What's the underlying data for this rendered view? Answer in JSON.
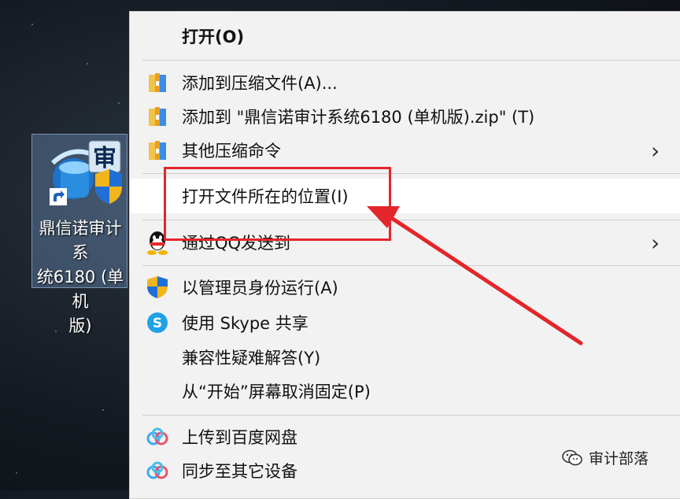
{
  "desktop": {
    "shortcut": {
      "label": "鼎信诺审计系\n统6180 (单机\n版)",
      "badge_text": "审"
    }
  },
  "menu": {
    "items": [
      {
        "label": "打开(O)",
        "bold": true,
        "icon": null,
        "submenu": false
      },
      {
        "label": "添加到压缩文件(A)...",
        "icon": "archive-icon",
        "submenu": false
      },
      {
        "label": "添加到 \"鼎信诺审计系统6180 (单机版).zip\" (T)",
        "icon": "archive-icon",
        "submenu": false
      },
      {
        "label": "其他压缩命令",
        "icon": "archive-icon",
        "submenu": true
      },
      {
        "label": "打开文件所在的位置(I)",
        "icon": null,
        "submenu": false,
        "highlighted": true
      },
      {
        "label": "通过QQ发送到",
        "icon": "qq-icon",
        "submenu": true
      },
      {
        "label": "以管理员身份运行(A)",
        "icon": "uac-shield-icon",
        "submenu": false
      },
      {
        "label": "使用 Skype 共享",
        "icon": "skype-icon",
        "submenu": false
      },
      {
        "label": "兼容性疑难解答(Y)",
        "icon": null,
        "submenu": false
      },
      {
        "label": "从“开始”屏幕取消固定(P)",
        "icon": null,
        "submenu": false
      },
      {
        "label": "上传到百度网盘",
        "icon": "baidu-netdisk-icon",
        "submenu": false
      },
      {
        "label": "同步至其它设备",
        "icon": "baidu-netdisk-icon",
        "submenu": false
      }
    ],
    "submenu_arrow": "›"
  },
  "annotation": {
    "color": "#e3262b"
  },
  "watermark": {
    "text": "审计部落"
  }
}
